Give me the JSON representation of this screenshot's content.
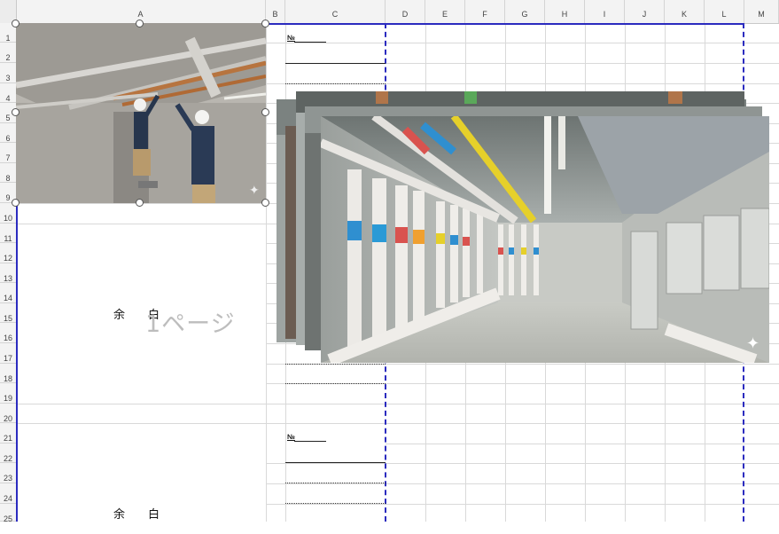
{
  "columns": [
    "A",
    "B",
    "C",
    "D",
    "E",
    "F",
    "G",
    "H",
    "I",
    "J",
    "K",
    "L",
    "M"
  ],
  "rows": [
    "1",
    "2",
    "3",
    "4",
    "5",
    "6",
    "7",
    "8",
    "9",
    "10",
    "11",
    "12",
    "13",
    "14",
    "15",
    "16",
    "17",
    "18",
    "19",
    "20",
    "21",
    "22",
    "23",
    "24",
    "25"
  ],
  "sections": [
    {
      "no_label": "№",
      "blank_label": "余　　白"
    },
    {
      "no_label": "№",
      "blank_label": "余　　白"
    }
  ],
  "page_watermark": "1ページ",
  "images": {
    "workers_photo": "workers-installing-ceiling-pipes-photo",
    "pipe_room_photo": "mechanical-pipe-room-photo"
  },
  "colors": {
    "page_break": "#2b2bbf",
    "grid": "#d9d9d9",
    "header_bg": "#f3f3f3"
  }
}
